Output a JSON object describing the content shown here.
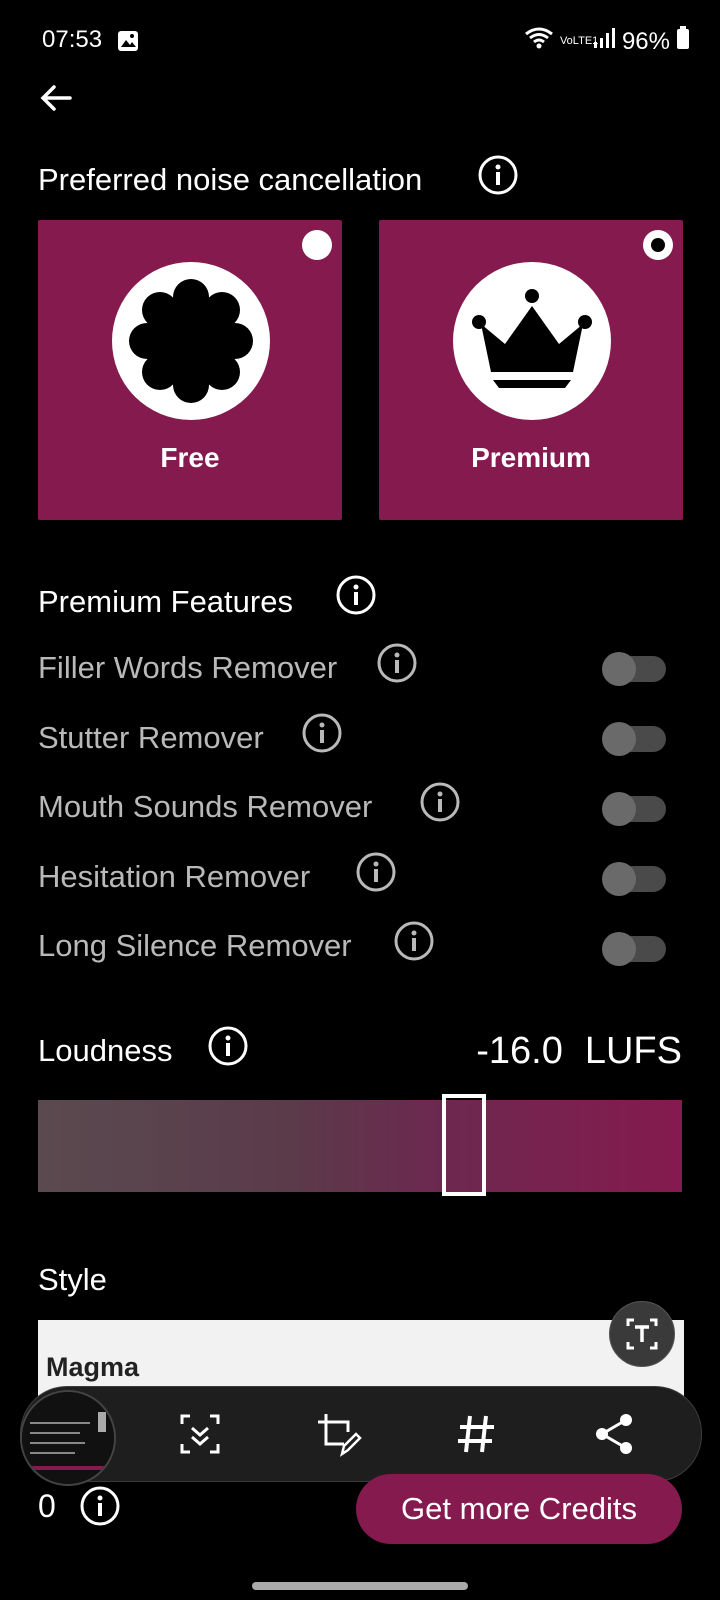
{
  "status": {
    "time": "07:53",
    "battery": "96%",
    "net": "VoLTE1"
  },
  "header": {
    "title": "Preferred noise cancellation"
  },
  "plans": [
    {
      "label": "Free",
      "selected": false,
      "icon": "badge-icon"
    },
    {
      "label": "Premium",
      "selected": true,
      "icon": "crown-icon"
    }
  ],
  "premium": {
    "title": "Premium Features",
    "items": [
      {
        "label": "Filler Words Remover",
        "on": false
      },
      {
        "label": "Stutter Remover",
        "on": false
      },
      {
        "label": "Mouth Sounds Remover",
        "on": false
      },
      {
        "label": "Hesitation Remover",
        "on": false
      },
      {
        "label": "Long Silence Remover",
        "on": false
      }
    ]
  },
  "loudness": {
    "title": "Loudness",
    "value": "-16.0",
    "unit": "LUFS"
  },
  "style": {
    "title": "Style",
    "selected": "Magma"
  },
  "footer": {
    "credits": "0",
    "button": "Get more Credits"
  },
  "colors": {
    "accent": "#851a4f",
    "background": "#000000"
  }
}
